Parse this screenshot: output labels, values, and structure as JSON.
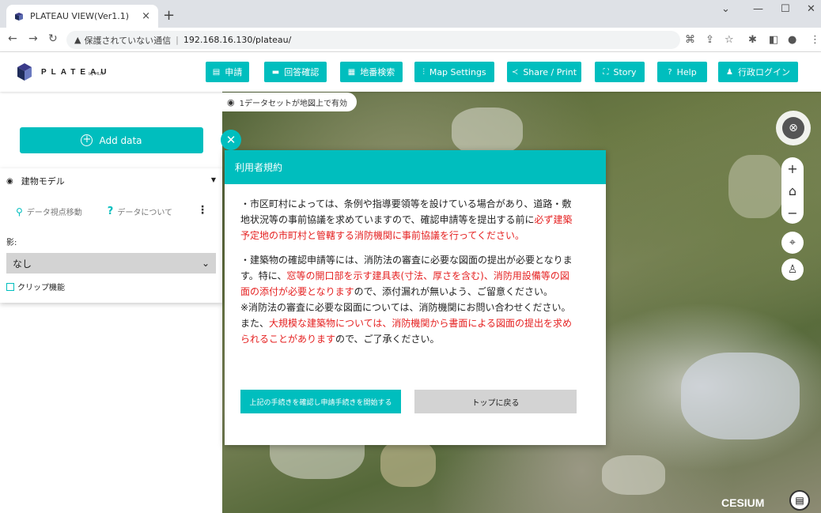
{
  "browser": {
    "tab_title": "PLATEAU VIEW(Ver1.1)",
    "tab_close": "×",
    "new_tab": "+",
    "security_warning": "保護されていない通信",
    "url": "192.168.16.130/plateau/"
  },
  "app": {
    "logo_text": "PLATEAU",
    "logo_sub": "by MLIT",
    "nav": [
      {
        "label": "申請",
        "icon": "document-icon"
      },
      {
        "label": "回答確認",
        "icon": "message-icon"
      },
      {
        "label": "地番検索",
        "icon": "building-icon"
      },
      {
        "label": "Map Settings",
        "icon": "sliders-icon"
      },
      {
        "label": "Share / Print",
        "icon": "share-icon"
      },
      {
        "label": "Story",
        "icon": "story-icon"
      },
      {
        "label": "Help",
        "icon": "help-icon"
      },
      {
        "label": "行政ログイン",
        "icon": "user-icon"
      }
    ]
  },
  "status": {
    "text": "1データセットが地図上で有効"
  },
  "left_panel": {
    "add_data": "Add data",
    "dataset": {
      "title": "建物モデル",
      "link_move": "データ視点移動",
      "link_about": "データについて"
    },
    "shadow_label": "影:",
    "shadow_value": "なし",
    "clip_label": "クリップ機能"
  },
  "modal": {
    "title": "利用者規約",
    "para1_normal": "・市区町村によっては、条例や指導要領等を設けている場合があり、道路・敷地状況等の事前協議を求めていますので、確認申請等を提出する前に",
    "para1_red": "必ず建築予定地の市町村と管轄する消防機関に事前協議を行ってください。",
    "para2_a": "・建築物の確認申請等には、消防法の審査に必要な図面の提出が必要となります。特に、",
    "para2_red": "窓等の開口部を示す建具表(寸法、厚さを含む)、消防用設備等の図面の添付が必要となります",
    "para2_b": "ので、添付漏れが無いよう、ご留意ください。",
    "para3_a": "※消防法の審査に必要な図面については、消防機関にお問い合わせください。また、",
    "para3_red": "大規模な建築物については、消防機関から書面による図面の提出を求められることがあります",
    "para3_b": "ので、ご了承ください。",
    "accept_button": "上記の手続きを確認し申請手続きを開始する",
    "back_button": "トップに戻る"
  },
  "map": {
    "attribution": "CESIUM"
  },
  "colors": {
    "accent": "#00bebe",
    "warning_text": "#e52121"
  }
}
